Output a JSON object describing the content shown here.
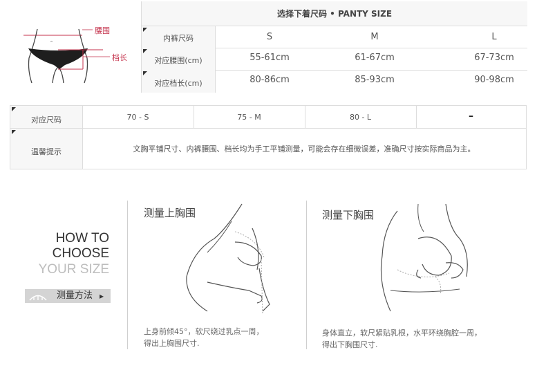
{
  "panty_illustration": {
    "waist_label": "腰围",
    "rise_label": "档长"
  },
  "panty_table": {
    "title": "选择下着尺码 • PANTY SIZE",
    "header_label": "内裤尺码",
    "sizes": [
      "S",
      "M",
      "L"
    ],
    "rows": [
      {
        "label": "对应腰围(cm)",
        "values": [
          "55-61cm",
          "61-67cm",
          "67-73cm"
        ]
      },
      {
        "label": "对应档长(cm)",
        "values": [
          "80-86cm",
          "85-93cm",
          "90-98cm"
        ]
      }
    ]
  },
  "bra_table": {
    "size_label": "对应尺码",
    "sizes": [
      "70 - S",
      "75 - M",
      "80 - L",
      "–"
    ],
    "tip_label": "温馨提示",
    "tip_text": "文胸平铺尺寸、内裤腰围、档长均为手工平铺测量，可能会存在细微误差，准确尺寸按实际商品为主。"
  },
  "how_to": {
    "line1": "HOW TO",
    "line2": "CHOOSE",
    "line3": "YOUR SIZE",
    "method_label": "测量方法",
    "method_arrow": "▸"
  },
  "measure_upper": {
    "title": "测量上胸围",
    "desc_line1": "上身前倾45°，软尺绕过乳点一周，",
    "desc_line2": "得出上胸围尺寸."
  },
  "measure_lower": {
    "title": "测量下胸围",
    "desc_line1": "身体直立，软尺紧贴乳根，水平环绕胸腔一周，",
    "desc_line2": "得出下胸围尺寸."
  },
  "colors": {
    "accent_red": "#c4314b",
    "grid_border": "#dddddd",
    "header_bg": "#f7f7f7",
    "howto_dark": "#333333",
    "howto_light": "#bdbdbd",
    "method_bg": "#d4d4d4"
  }
}
